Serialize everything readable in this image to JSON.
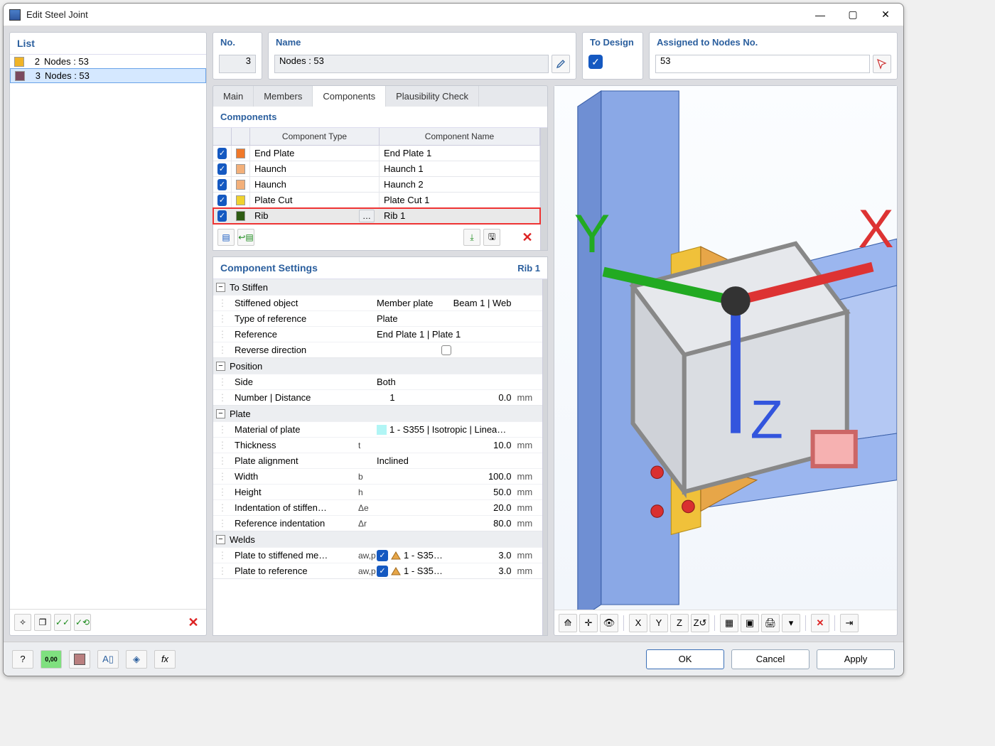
{
  "window": {
    "title": "Edit Steel Joint"
  },
  "list": {
    "title": "List",
    "items": [
      {
        "num": "2",
        "label": "Nodes : 53",
        "color": "#f0b428",
        "selected": false
      },
      {
        "num": "3",
        "label": "Nodes : 53",
        "color": "#7a4a60",
        "selected": true
      }
    ]
  },
  "header_fields": {
    "no_label": "No.",
    "no_value": "3",
    "name_label": "Name",
    "name_value": "Nodes : 53",
    "todesign_label": "To Design",
    "assigned_label": "Assigned to Nodes No.",
    "assigned_value": "53"
  },
  "tabs": [
    "Main",
    "Members",
    "Components",
    "Plausibility Check"
  ],
  "active_tab": 2,
  "components": {
    "title": "Components",
    "columns": {
      "type": "Component Type",
      "name": "Component Name"
    },
    "rows": [
      {
        "checked": true,
        "color": "#f0792a",
        "type": "End Plate",
        "name": "End Plate 1",
        "selected": false
      },
      {
        "checked": true,
        "color": "#f3b07a",
        "type": "Haunch",
        "name": "Haunch 1",
        "selected": false
      },
      {
        "checked": true,
        "color": "#f3b07a",
        "type": "Haunch",
        "name": "Haunch 2",
        "selected": false
      },
      {
        "checked": true,
        "color": "#f0d22e",
        "type": "Plate Cut",
        "name": "Plate Cut 1",
        "selected": false
      },
      {
        "checked": true,
        "color": "#2d5a12",
        "type": "Rib",
        "name": "Rib 1",
        "selected": true,
        "highlight": true
      }
    ]
  },
  "settings": {
    "title": "Component Settings",
    "current": "Rib 1",
    "groups": [
      {
        "name": "To Stiffen",
        "rows": [
          {
            "label": "Stiffened object",
            "value": "Member plate",
            "value_suffix": "Beam 1 | Web"
          },
          {
            "label": "Type of reference",
            "value": "Plate"
          },
          {
            "label": "Reference",
            "value": "End Plate 1 | Plate 1"
          },
          {
            "label": "Reverse direction",
            "type": "check",
            "checked": false
          }
        ]
      },
      {
        "name": "Position",
        "rows": [
          {
            "label": "Side",
            "value": "Both"
          },
          {
            "label": "Number | Distance",
            "value": "1",
            "value_suffix": "0.0",
            "unit": "mm"
          }
        ]
      },
      {
        "name": "Plate",
        "rows": [
          {
            "label": "Material of plate",
            "type": "material",
            "value": "1 - S355 | Isotropic | Linea…"
          },
          {
            "label": "Thickness",
            "symbol": "t",
            "value": "10.0",
            "unit": "mm"
          },
          {
            "label": "Plate alignment",
            "value": "Inclined"
          },
          {
            "label": "Width",
            "symbol": "b",
            "value": "100.0",
            "unit": "mm"
          },
          {
            "label": "Height",
            "symbol": "h",
            "value": "50.0",
            "unit": "mm"
          },
          {
            "label": "Indentation of stiffen…",
            "symbol": "Δe",
            "value": "20.0",
            "unit": "mm"
          },
          {
            "label": "Reference indentation",
            "symbol": "Δr",
            "value": "80.0",
            "unit": "mm"
          }
        ]
      },
      {
        "name": "Welds",
        "rows": [
          {
            "label": "Plate to stiffened me…",
            "symbol": "aw,p…",
            "type": "weld",
            "checked": true,
            "weld_spec": "1 - S35…",
            "value": "3.0",
            "unit": "mm"
          },
          {
            "label": "Plate to reference",
            "symbol": "aw,p…",
            "type": "weld",
            "checked": true,
            "weld_spec": "1 - S35…",
            "value": "3.0",
            "unit": "mm"
          }
        ]
      }
    ]
  },
  "viewer_toolbar": [
    "view-reset",
    "axis-gizmo",
    "perspective",
    "|",
    "x-view",
    "y-view",
    "z-view",
    "iso-view",
    "|",
    "section",
    "wireframe",
    "print",
    "more",
    "|",
    "delete-view",
    "|",
    "restore"
  ],
  "footer": {
    "ok": "OK",
    "cancel": "Cancel",
    "apply": "Apply"
  }
}
